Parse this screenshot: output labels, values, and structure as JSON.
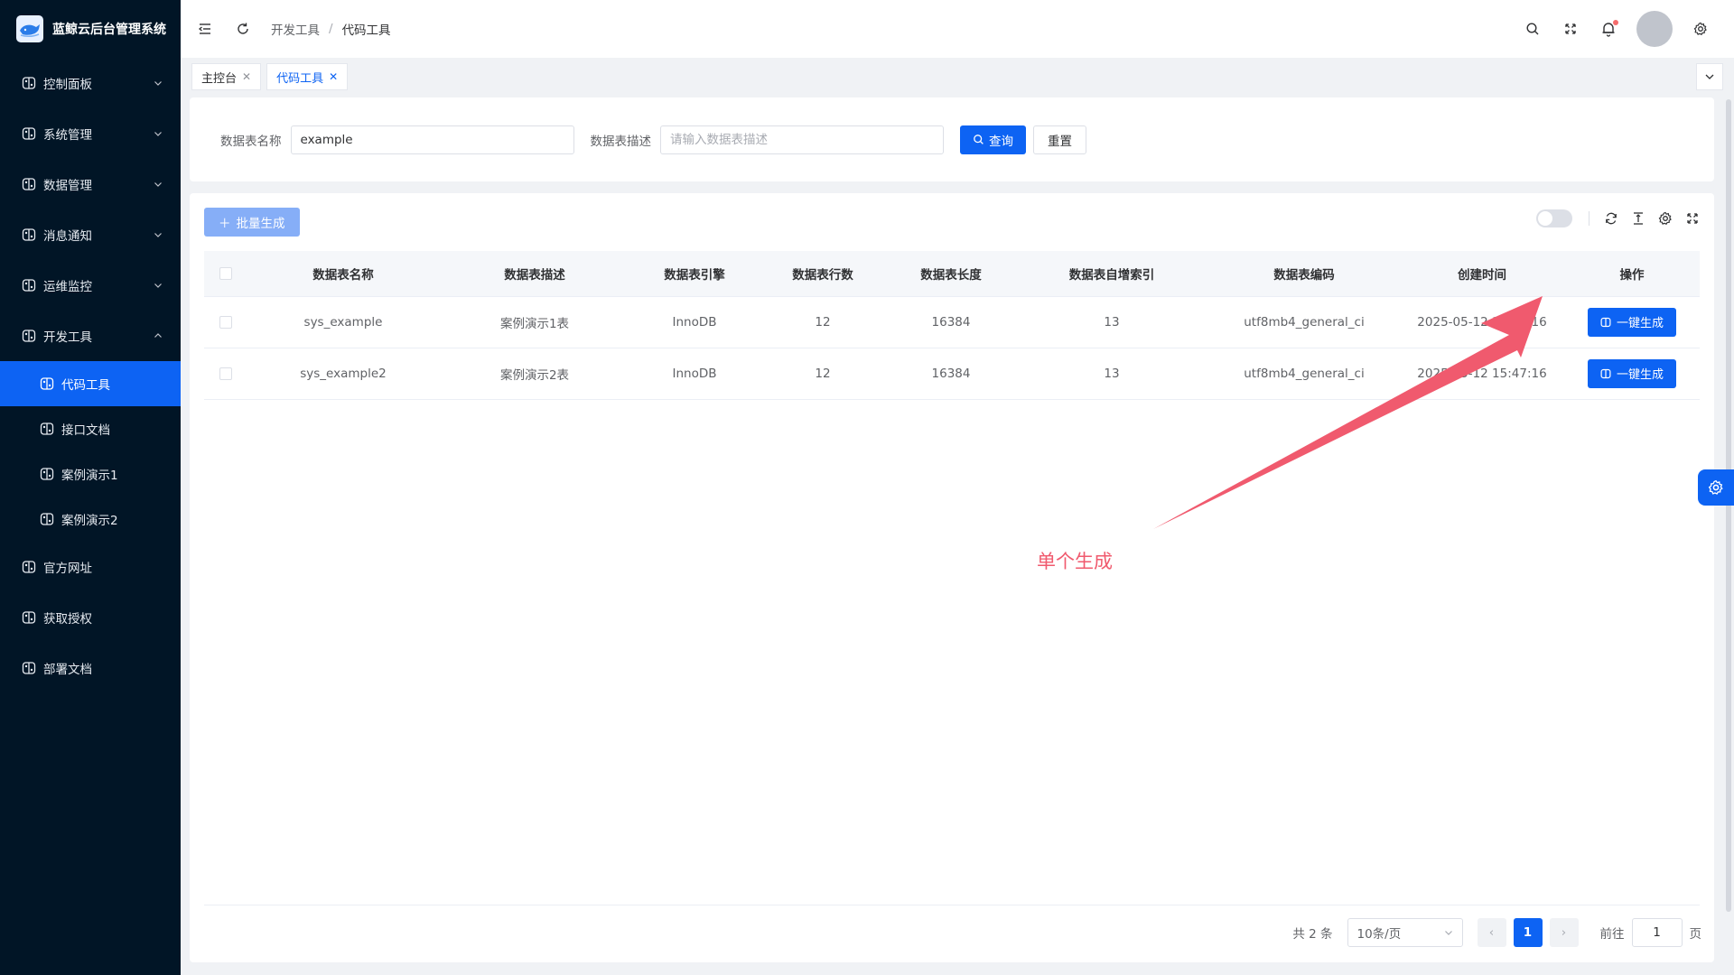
{
  "app": {
    "title": "蓝鲸云后台管理系统"
  },
  "sidebar": {
    "items": [
      {
        "label": "控制面板",
        "expanded": false
      },
      {
        "label": "系统管理",
        "expanded": false
      },
      {
        "label": "数据管理",
        "expanded": false
      },
      {
        "label": "消息通知",
        "expanded": false
      },
      {
        "label": "运维监控",
        "expanded": false
      },
      {
        "label": "开发工具",
        "expanded": true
      },
      {
        "label": "官方网址"
      },
      {
        "label": "获取授权"
      },
      {
        "label": "部署文档"
      }
    ],
    "dev_children": [
      {
        "label": "代码工具",
        "active": true
      },
      {
        "label": "接口文档"
      },
      {
        "label": "案例演示1"
      },
      {
        "label": "案例演示2"
      }
    ]
  },
  "breadcrumb": [
    "开发工具",
    "代码工具"
  ],
  "breadcrumb_separator": "/",
  "tags": [
    {
      "label": "主控台",
      "active": false
    },
    {
      "label": "代码工具",
      "active": true
    }
  ],
  "search": {
    "name_label": "数据表名称",
    "name_value": "example",
    "desc_label": "数据表描述",
    "desc_placeholder": "请输入数据表描述",
    "query_label": "查询",
    "reset_label": "重置"
  },
  "toolbar": {
    "batch_label": "批量生成"
  },
  "table": {
    "columns": [
      "数据表名称",
      "数据表描述",
      "数据表引擎",
      "数据表行数",
      "数据表长度",
      "数据表自增索引",
      "数据表编码",
      "创建时间",
      "操作"
    ],
    "rows": [
      {
        "name": "sys_example",
        "desc": "案例演示1表",
        "engine": "InnoDB",
        "rows": "12",
        "length": "16384",
        "auto_inc": "13",
        "charset": "utf8mb4_general_ci",
        "created": "2025-05-12 15:47:16",
        "action": "一键生成"
      },
      {
        "name": "sys_example2",
        "desc": "案例演示2表",
        "engine": "InnoDB",
        "rows": "12",
        "length": "16384",
        "auto_inc": "13",
        "charset": "utf8mb4_general_ci",
        "created": "2025-05-12 15:47:16",
        "action": "一键生成"
      }
    ]
  },
  "pagination": {
    "total_text": "共 2 条",
    "page_size": "10条/页",
    "current_page": "1",
    "goto_label": "前往",
    "goto_value": "1",
    "page_unit": "页"
  },
  "annotation": {
    "text": "单个生成",
    "color": "#f05a6e"
  },
  "colors": {
    "primary": "#0d63f3",
    "sidebar_bg": "#011526",
    "batch_disabled": "#86aef7"
  }
}
